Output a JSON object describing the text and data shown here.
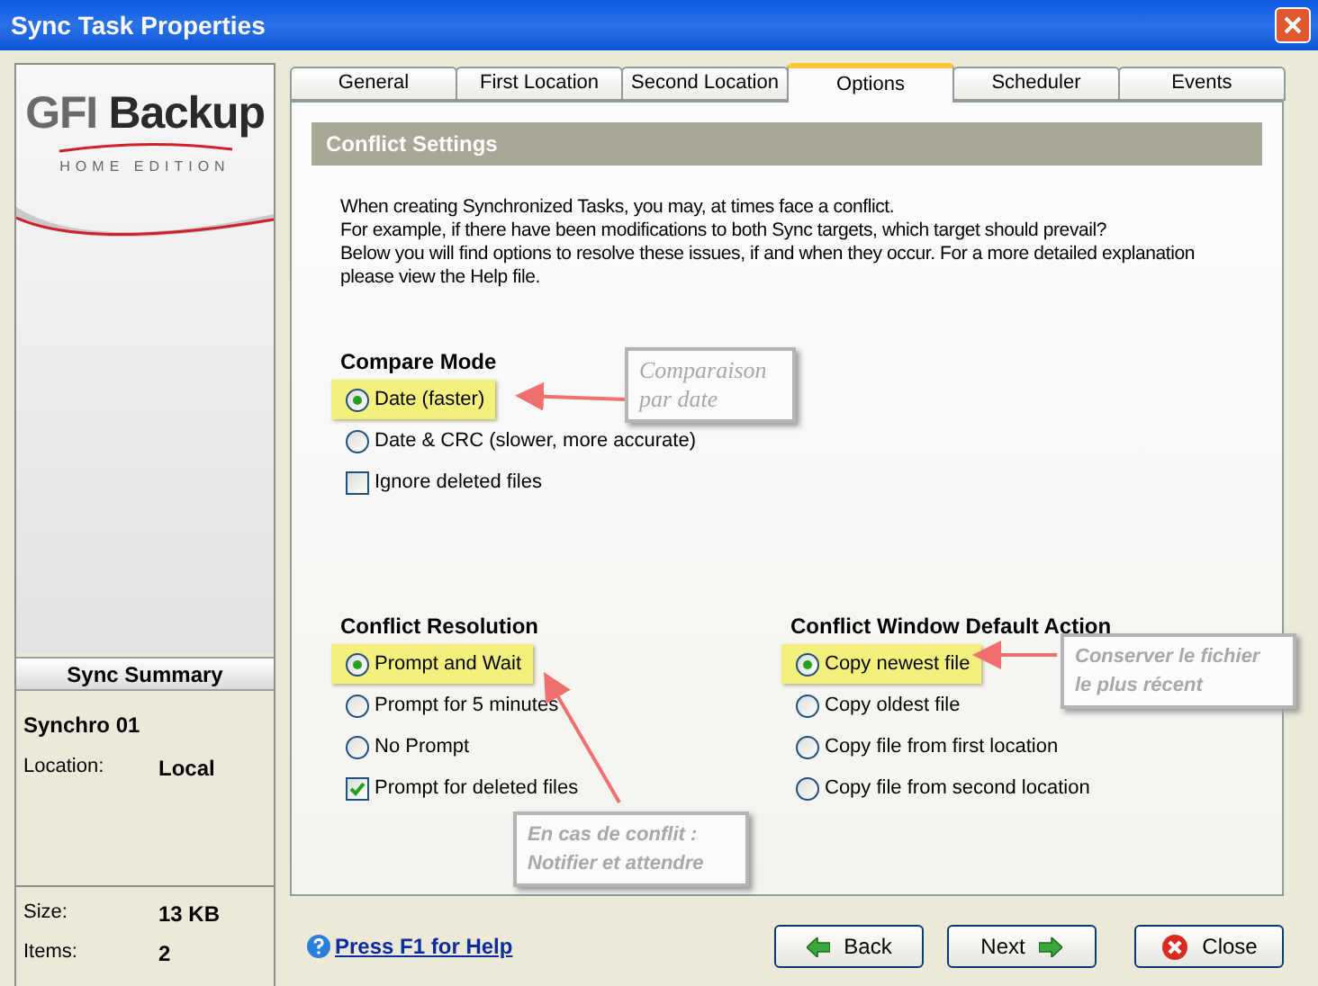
{
  "window": {
    "title": "Sync Task Properties"
  },
  "logo": {
    "brand": "GFI",
    "product": "Backup",
    "edition": "HOME EDITION"
  },
  "summary": {
    "title": "Sync Summary",
    "name": "Synchro 01",
    "fields": [
      {
        "label": "Location:",
        "value": "Local"
      }
    ],
    "stats": [
      {
        "label": "Size:",
        "value": "13 KB"
      },
      {
        "label": "Items:",
        "value": "2"
      }
    ]
  },
  "tabs": [
    {
      "label": "General",
      "selected": false
    },
    {
      "label": "First Location",
      "selected": false
    },
    {
      "label": "Second Location",
      "selected": false
    },
    {
      "label": "Options",
      "selected": true
    },
    {
      "label": "Scheduler",
      "selected": false
    },
    {
      "label": "Events",
      "selected": false
    }
  ],
  "section_title": "Conflict Settings",
  "intro": [
    "When creating Synchronized Tasks, you may, at times face a conflict.",
    "For example, if there have been modifications to both Sync targets, which target should prevail?",
    "Below you will find options to resolve these issues, if and when they occur. For a more detailed explanation",
    "please view the Help file."
  ],
  "compare_mode": {
    "title": "Compare Mode",
    "options": [
      {
        "kind": "radio",
        "label": "Date (faster)",
        "selected": true,
        "highlighted": true
      },
      {
        "kind": "radio",
        "label": "Date & CRC (slower, more accurate)",
        "selected": false,
        "highlighted": false
      },
      {
        "kind": "checkbox",
        "label": "Ignore deleted files",
        "checked": false,
        "highlighted": false
      }
    ]
  },
  "conflict_resolution": {
    "title": "Conflict Resolution",
    "options": [
      {
        "kind": "radio",
        "label": "Prompt and Wait",
        "selected": true,
        "highlighted": true
      },
      {
        "kind": "radio",
        "label": "Prompt for 5 minutes",
        "selected": false,
        "highlighted": false
      },
      {
        "kind": "radio",
        "label": "No Prompt",
        "selected": false,
        "highlighted": false
      },
      {
        "kind": "checkbox",
        "label": "Prompt for deleted files",
        "checked": true,
        "highlighted": false
      }
    ]
  },
  "default_action": {
    "title": "Conflict Window Default Action",
    "options": [
      {
        "kind": "radio",
        "label": "Copy newest file",
        "selected": true,
        "highlighted": true
      },
      {
        "kind": "radio",
        "label": "Copy oldest file",
        "selected": false,
        "highlighted": false
      },
      {
        "kind": "radio",
        "label": "Copy file from first location",
        "selected": false,
        "highlighted": false
      },
      {
        "kind": "radio",
        "label": "Copy file from second location",
        "selected": false,
        "highlighted": false
      }
    ]
  },
  "help_link": "Press F1 for Help",
  "buttons": [
    {
      "kind": "back",
      "label": "Back"
    },
    {
      "kind": "next",
      "label": "Next"
    },
    {
      "kind": "close",
      "label": "Close"
    }
  ],
  "annotations": [
    {
      "lines": [
        "Comparaison",
        "par date"
      ]
    },
    {
      "lines": [
        "Conserver le fichier",
        "le plus récent"
      ]
    },
    {
      "lines": [
        "En cas de conflit :",
        "Notifier et attendre"
      ]
    }
  ]
}
